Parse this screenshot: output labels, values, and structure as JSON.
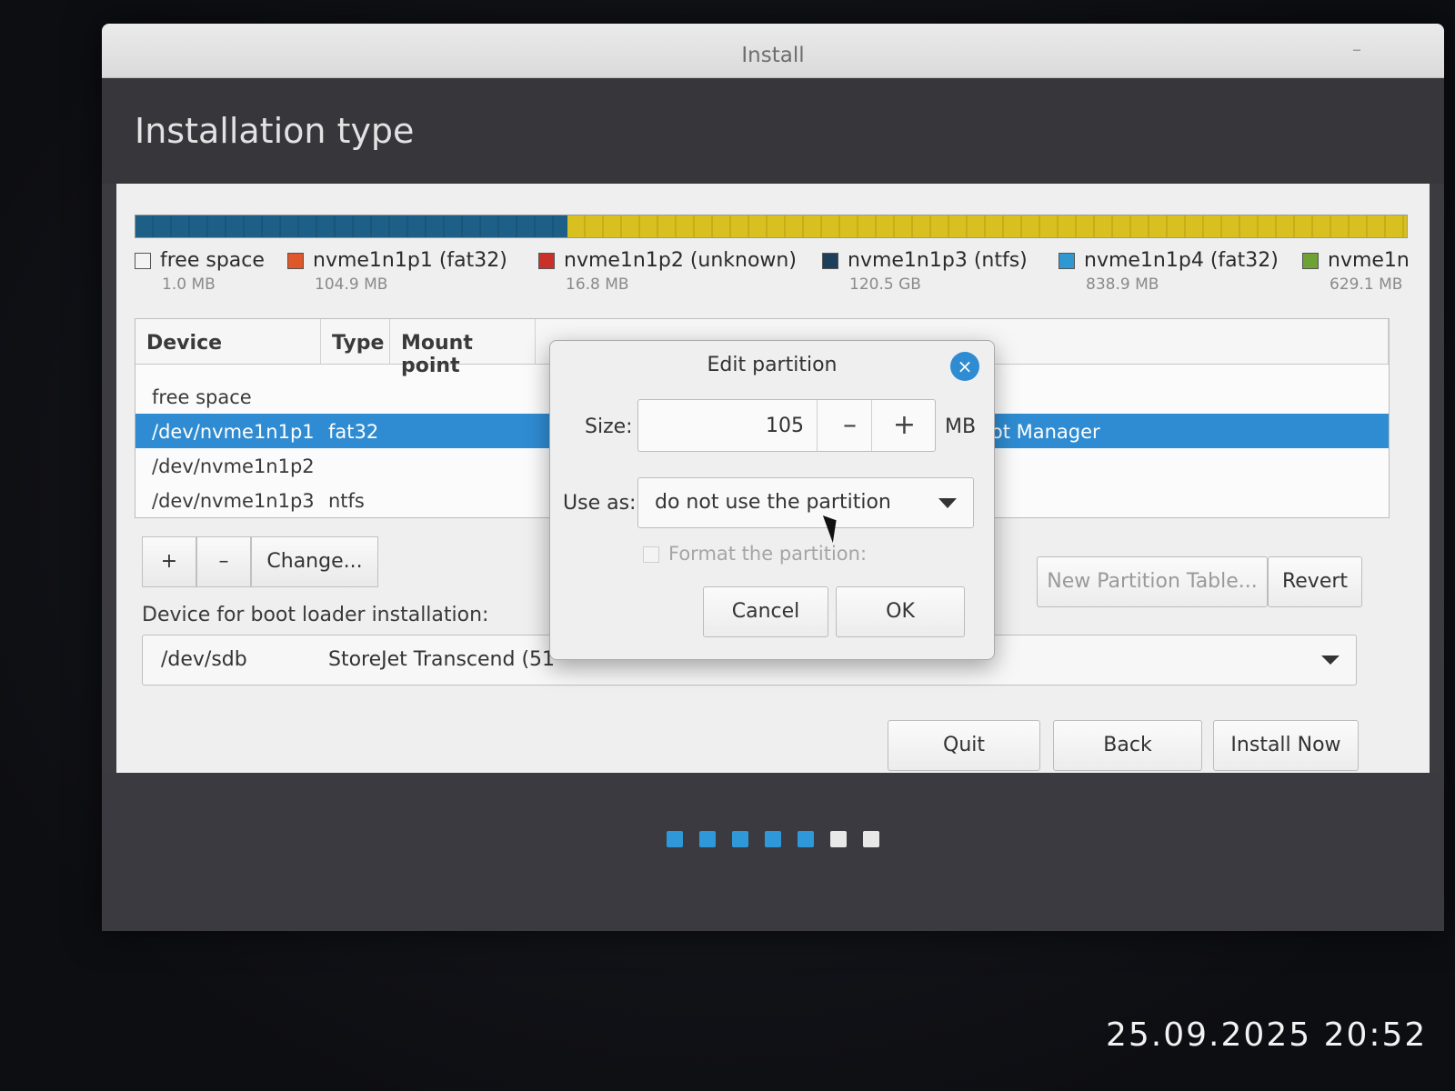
{
  "window": {
    "title": "Install",
    "minimize": "–",
    "close": "×"
  },
  "header": {
    "page_title": "Installation type"
  },
  "partition_bar": {
    "segments": [
      {
        "color": "#1d5f86",
        "fraction": 0.34
      },
      {
        "color": "#d8c020",
        "fraction": 0.66
      }
    ]
  },
  "legend": [
    {
      "name": "free space",
      "size": "1.0 MB",
      "color": "#f3f3f3"
    },
    {
      "name": "nvme1n1p1 (fat32)",
      "size": "104.9 MB",
      "color": "#e0582a"
    },
    {
      "name": "nvme1n1p2 (unknown)",
      "size": "16.8 MB",
      "color": "#c9302a"
    },
    {
      "name": "nvme1n1p3 (ntfs)",
      "size": "120.5 GB",
      "color": "#1d3f5c"
    },
    {
      "name": "nvme1n1p4 (fat32)",
      "size": "838.9 MB",
      "color": "#2f98d0"
    },
    {
      "name": "nvme1n",
      "size": "629.1 MB",
      "color": "#6fa234"
    }
  ],
  "table": {
    "headers": {
      "device": "Device",
      "type": "Type",
      "mount": "Mount point"
    },
    "rows": [
      {
        "device": "free space",
        "type": "",
        "extra": ""
      },
      {
        "device": "/dev/nvme1n1p1",
        "type": "fat32",
        "extra": "oot Manager"
      },
      {
        "device": "/dev/nvme1n1p2",
        "type": "",
        "extra": ""
      },
      {
        "device": "/dev/nvme1n1p3",
        "type": "ntfs",
        "extra": ""
      }
    ]
  },
  "table_buttons": {
    "add": "+",
    "remove": "–",
    "change": "Change...",
    "new_table": "New Partition Table...",
    "revert": "Revert"
  },
  "boot_loader": {
    "label": "Device for boot loader installation:",
    "device": "/dev/sdb",
    "name": "StoreJet Transcend (51"
  },
  "actions": {
    "quit": "Quit",
    "back": "Back",
    "install": "Install Now"
  },
  "dots": [
    {
      "color": "#2f98d8"
    },
    {
      "color": "#2f98d8"
    },
    {
      "color": "#2f98d8"
    },
    {
      "color": "#2f98d8"
    },
    {
      "color": "#2f98d8"
    },
    {
      "color": "#e8e8e8"
    },
    {
      "color": "#e8e8e8"
    }
  ],
  "dialog": {
    "title": "Edit partition",
    "close": "×",
    "size_label": "Size:",
    "size_value": "105",
    "minus": "–",
    "plus": "+",
    "unit": "MB",
    "use_as_label": "Use as:",
    "use_as_value": "do not use the partition",
    "format_label": "Format the partition:",
    "cancel": "Cancel",
    "ok": "OK"
  },
  "photo_timestamp": "25.09.2025 20:52"
}
